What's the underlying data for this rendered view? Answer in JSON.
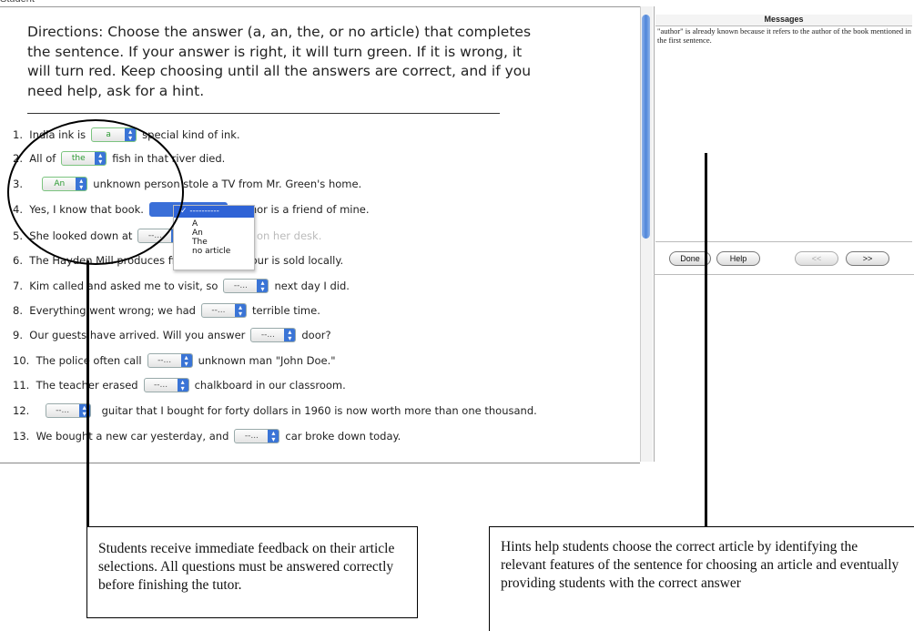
{
  "window": {
    "title": "Student"
  },
  "directions": "Directions: Choose the answer (a, an, the, or no article) that completes the sentence. If your answer is right, it will turn green. If it is wrong, it will turn red. Keep choosing until all the answers are correct, and if you need help, ask for a hint.",
  "questions": [
    {
      "num": "1.",
      "before": "India ink is",
      "select": "a",
      "after": "special kind of ink."
    },
    {
      "num": "2.",
      "before": "All of",
      "select": "the",
      "after": "fish in that river died."
    },
    {
      "num": "3.",
      "before": "",
      "select": "An",
      "after": "unknown person stole a TV from Mr. Green's home."
    },
    {
      "num": "4.",
      "before": "Yes, I know that book.",
      "select": "",
      "after": "author is a friend of mine."
    },
    {
      "num": "5.",
      "before": "She looked down at",
      "select": "--...",
      "after": "papers lying on her desk."
    },
    {
      "num": "6.",
      "before": "The Hayden Mill produces fine",
      "select": "--...",
      "after": "flour is sold locally."
    },
    {
      "num": "7.",
      "before": "Kim called and asked me to visit, so",
      "select": "--...",
      "after": "next day I did."
    },
    {
      "num": "8.",
      "before": "Everything went wrong; we had",
      "select": "--...",
      "after": "terrible time."
    },
    {
      "num": "9.",
      "before": "Our guests have arrived. Will you answer",
      "select": "--...",
      "after": "door?"
    },
    {
      "num": "10.",
      "before": "The police often call",
      "select": "--...",
      "after": "unknown man \"John Doe.\""
    },
    {
      "num": "11.",
      "before": "The teacher erased",
      "select": "--...",
      "after": "chalkboard in our classroom."
    },
    {
      "num": "12.",
      "before": "",
      "select": "--...",
      "after": "guitar that I bought for forty dollars in 1960 is now worth more than one thousand."
    },
    {
      "num": "13.",
      "before": "We bought a new car yesterday, and",
      "select": "--...",
      "after": "car broke down today."
    }
  ],
  "dropdown": {
    "current": "✓ ----------",
    "options": [
      "A",
      "An",
      "The",
      "no article"
    ]
  },
  "messages": {
    "title": "Messages",
    "text": "\"author\" is already known because it refers to the author of the book mentioned in the first sentence."
  },
  "buttons": {
    "done": "Done",
    "help": "Help",
    "prev": "<<",
    "next": ">>"
  },
  "callouts": {
    "left": "Students receive immediate feedback on their article selections. All questions must be answered correctly before finishing the tutor.",
    "right": "Hints help students choose the correct article by identifying the relevant features of the sentence for choosing an article and eventually providing students with the correct answer"
  },
  "colors": {
    "correct": "#2e9b34",
    "accent": "#3a74d6"
  }
}
